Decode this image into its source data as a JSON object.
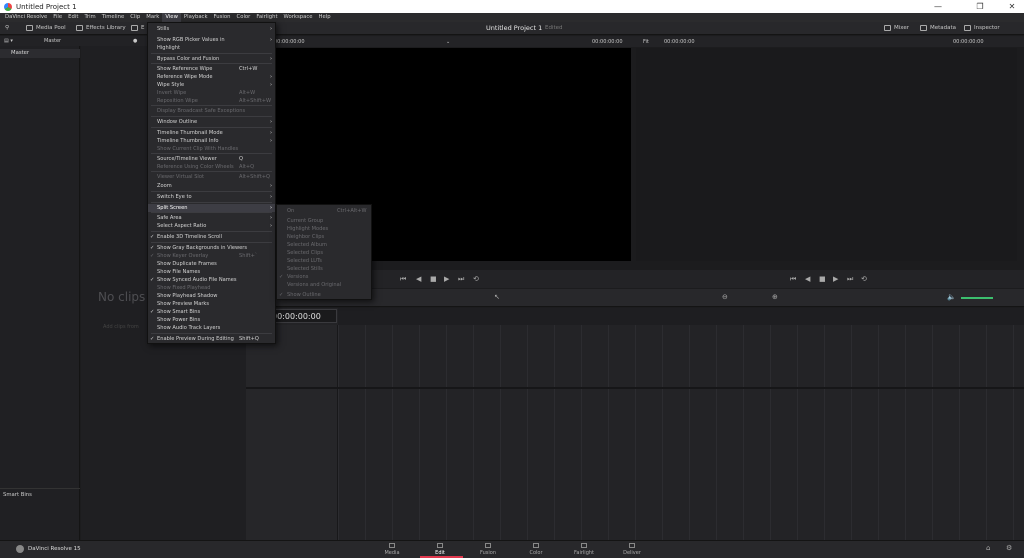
{
  "window": {
    "title": "Untitled Project 1",
    "minimize": "—",
    "maximize": "❐",
    "close": "✕"
  },
  "menubar": [
    "DaVinci Resolve",
    "File",
    "Edit",
    "Trim",
    "Timeline",
    "Clip",
    "Mark",
    "View",
    "Playback",
    "Fusion",
    "Color",
    "Fairlight",
    "Workspace",
    "Help"
  ],
  "toolbar": {
    "media_pool": "Media Pool",
    "effects_library": "Effects Library",
    "e_trunc": "E",
    "project_title": "Untitled Project 1",
    "edited": "Edited",
    "mixer": "Mixer",
    "metadata": "Metadata",
    "inspector": "Inspector"
  },
  "subbar": {
    "master": "Master"
  },
  "viewer": {
    "src_tc_left": "00:00:00:00",
    "src_tc_right": "00:00:00:00",
    "fit": "Fit",
    "tl_tc_left": "00:00:00:00",
    "tl_tc_right": "00:00:00:00"
  },
  "leftpanel": {
    "master": "Master",
    "smart_bins": "Smart Bins"
  },
  "pool": {
    "no_clips": "No clips",
    "add_clips": "Add clips from"
  },
  "timeline": {
    "timecode": "00:00:00:00"
  },
  "view_menu": [
    {
      "label": "Stills",
      "arrow": true
    },
    {
      "label": "Show RGB Picker Values in",
      "arrow": true
    },
    {
      "label": "Highlight"
    },
    {
      "label": "Bypass Color and Fusion",
      "arrow": true
    },
    {
      "label": "Show Reference Wipe",
      "shortcut": "Ctrl+W"
    },
    {
      "label": "Reference Wipe Mode",
      "arrow": true
    },
    {
      "label": "Wipe Style",
      "arrow": true
    },
    {
      "label": "Invert Wipe",
      "shortcut": "Alt+W",
      "disabled": true
    },
    {
      "label": "Reposition Wipe",
      "shortcut": "Alt+Shift+W",
      "disabled": true
    },
    {
      "label": "Display Broadcast Safe Exceptions",
      "disabled": true
    },
    {
      "label": "Window Outline",
      "arrow": true
    },
    {
      "label": "Timeline Thumbnail Mode",
      "arrow": true
    },
    {
      "label": "Timeline Thumbnail Info",
      "arrow": true
    },
    {
      "label": "Show Current Clip With Handles",
      "disabled": true
    },
    {
      "label": "Source/Timeline Viewer",
      "shortcut": "Q"
    },
    {
      "label": "Reference Using Color Wheels",
      "shortcut": "Alt+Q",
      "disabled": true
    },
    {
      "label": "Viewer Virtual Slot",
      "shortcut": "Alt+Shift+Q",
      "disabled": true
    },
    {
      "label": "Zoom",
      "arrow": true
    },
    {
      "label": "Switch Eye to",
      "arrow": true
    },
    {
      "label": "Split Screen",
      "arrow": true,
      "highlight": true
    },
    {
      "label": "Safe Area",
      "arrow": true
    },
    {
      "label": "Select Aspect Ratio",
      "arrow": true
    },
    {
      "label": "Enable 3D Timeline Scroll",
      "checked": true
    },
    {
      "label": "Show Gray Backgrounds in Viewers",
      "checked": true
    },
    {
      "label": "Show Keyer Overlay",
      "shortcut": "Shift+`",
      "checked": true,
      "disabled": true
    },
    {
      "label": "Show Duplicate Frames"
    },
    {
      "label": "Show File Names"
    },
    {
      "label": "Show Synced Audio File Names",
      "checked": true
    },
    {
      "label": "Show Fixed Playhead",
      "disabled": true
    },
    {
      "label": "Show Playhead Shadow"
    },
    {
      "label": "Show Preview Marks"
    },
    {
      "label": "Show Smart Bins",
      "checked": true
    },
    {
      "label": "Show Power Bins"
    },
    {
      "label": "Show Audio Track Layers"
    },
    {
      "label": "Enable Preview During Editing",
      "shortcut": "Shift+Q",
      "checked": true
    }
  ],
  "split_menu": [
    {
      "label": "On",
      "shortcut": "Ctrl+Alt+W"
    },
    {
      "label": "Current Group"
    },
    {
      "label": "Highlight Modes"
    },
    {
      "label": "Neighbor Clips"
    },
    {
      "label": "Selected Album"
    },
    {
      "label": "Selected Clips"
    },
    {
      "label": "Selected LUTs"
    },
    {
      "label": "Selected Stills"
    },
    {
      "label": "Versions",
      "checked": true
    },
    {
      "label": "Versions and Original"
    },
    {
      "label": "Show Outline",
      "checked": true
    }
  ],
  "pages": [
    "Media",
    "Edit",
    "Fusion",
    "Color",
    "Fairlight",
    "Deliver"
  ],
  "brand": "DaVinci Resolve 15",
  "colors": {
    "accent": "#e0384e",
    "menu_bg": "#2a2a2d",
    "app_bg": "#1c1c1e"
  }
}
